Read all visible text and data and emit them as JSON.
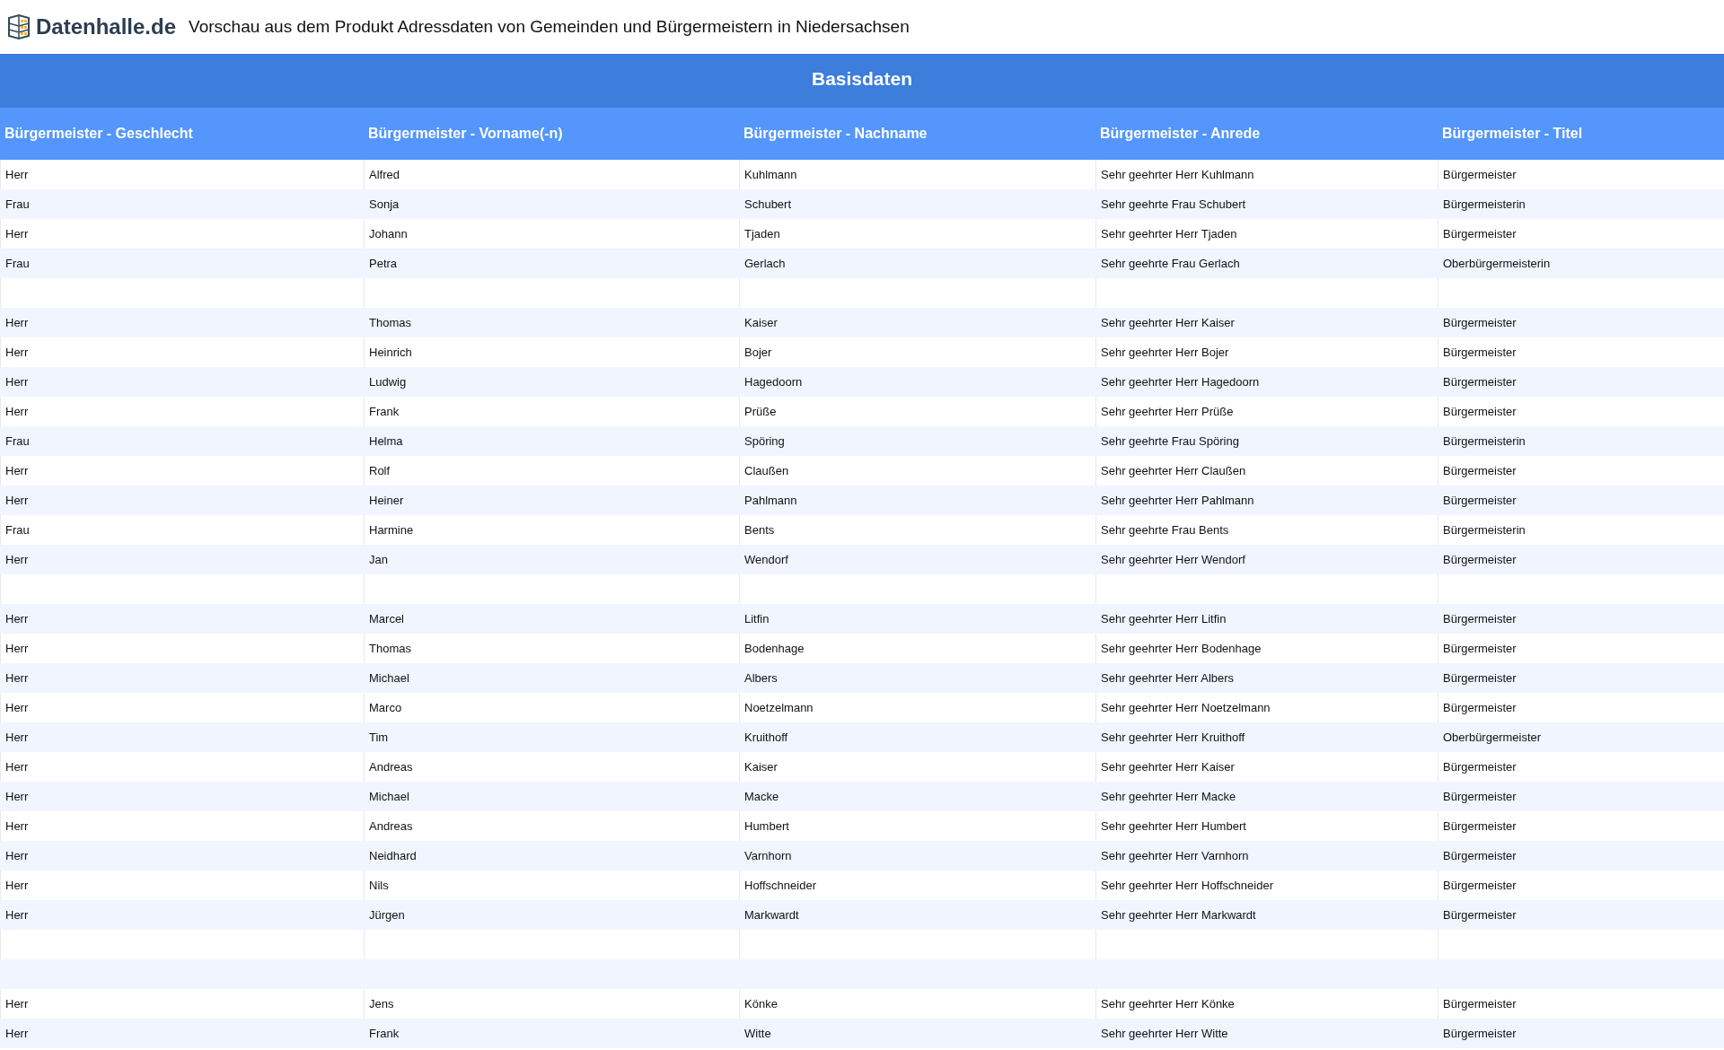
{
  "header": {
    "logo_text": "Datenhalle.de",
    "title": "Vorschau aus dem Produkt Adressdaten von Gemeinden und Bürgermeistern in Niedersachsen"
  },
  "table": {
    "group_title": "Basisdaten",
    "columns": [
      "Bürgermeister - Geschlecht",
      "Bürgermeister - Vorname(-n)",
      "Bürgermeister - Nachname",
      "Bürgermeister - Anrede",
      "Bürgermeister - Titel"
    ],
    "rows": [
      {
        "kind": "data",
        "cells": [
          "Herr",
          "Alfred",
          "Kuhlmann",
          "Sehr geehrter Herr Kuhlmann",
          "Bürgermeister"
        ]
      },
      {
        "kind": "data",
        "cells": [
          "Frau",
          "Sonja",
          "Schubert",
          "Sehr geehrte Frau Schubert",
          "Bürgermeisterin"
        ]
      },
      {
        "kind": "data",
        "cells": [
          "Herr",
          "Johann",
          "Tjaden",
          "Sehr geehrter Herr Tjaden",
          "Bürgermeister"
        ]
      },
      {
        "kind": "data",
        "cells": [
          "Frau",
          "Petra",
          "Gerlach",
          "Sehr geehrte Frau Gerlach",
          "Oberbürgermeisterin"
        ]
      },
      {
        "kind": "blank"
      },
      {
        "kind": "data",
        "cells": [
          "Herr",
          "Thomas",
          "Kaiser",
          "Sehr geehrter Herr Kaiser",
          "Bürgermeister"
        ]
      },
      {
        "kind": "data",
        "cells": [
          "Herr",
          "Heinrich",
          "Bojer",
          "Sehr geehrter Herr Bojer",
          "Bürgermeister"
        ]
      },
      {
        "kind": "data",
        "cells": [
          "Herr",
          "Ludwig",
          "Hagedoorn",
          "Sehr geehrter Herr Hagedoorn",
          "Bürgermeister"
        ]
      },
      {
        "kind": "data",
        "cells": [
          "Herr",
          "Frank",
          "Prüße",
          "Sehr geehrter Herr Prüße",
          "Bürgermeister"
        ]
      },
      {
        "kind": "data",
        "cells": [
          "Frau",
          "Helma",
          "Spöring",
          "Sehr geehrte Frau Spöring",
          "Bürgermeisterin"
        ]
      },
      {
        "kind": "data",
        "cells": [
          "Herr",
          "Rolf",
          "Claußen",
          "Sehr geehrter Herr Claußen",
          "Bürgermeister"
        ]
      },
      {
        "kind": "data",
        "cells": [
          "Herr",
          "Heiner",
          "Pahlmann",
          "Sehr geehrter Herr Pahlmann",
          "Bürgermeister"
        ]
      },
      {
        "kind": "data",
        "cells": [
          "Frau",
          "Harmine",
          "Bents",
          "Sehr geehrte Frau Bents",
          "Bürgermeisterin"
        ]
      },
      {
        "kind": "data",
        "cells": [
          "Herr",
          "Jan",
          "Wendorf",
          "Sehr geehrter Herr Wendorf",
          "Bürgermeister"
        ]
      },
      {
        "kind": "blank"
      },
      {
        "kind": "data",
        "cells": [
          "Herr",
          "Marcel",
          "Litfin",
          "Sehr geehrter Herr Litfin",
          "Bürgermeister"
        ]
      },
      {
        "kind": "data",
        "cells": [
          "Herr",
          "Thomas",
          "Bodenhage",
          "Sehr geehrter Herr Bodenhage",
          "Bürgermeister"
        ]
      },
      {
        "kind": "data",
        "cells": [
          "Herr",
          "Michael",
          "Albers",
          "Sehr geehrter Herr Albers",
          "Bürgermeister"
        ]
      },
      {
        "kind": "data",
        "cells": [
          "Herr",
          "Marco",
          "Noetzelmann",
          "Sehr geehrter Herr Noetzelmann",
          "Bürgermeister"
        ]
      },
      {
        "kind": "data",
        "cells": [
          "Herr",
          "Tim",
          "Kruithoff",
          "Sehr geehrter Herr Kruithoff",
          "Oberbürgermeister"
        ]
      },
      {
        "kind": "data",
        "cells": [
          "Herr",
          "Andreas",
          "Kaiser",
          "Sehr geehrter Herr Kaiser",
          "Bürgermeister"
        ]
      },
      {
        "kind": "data",
        "cells": [
          "Herr",
          "Michael",
          "Macke",
          "Sehr geehrter Herr Macke",
          "Bürgermeister"
        ]
      },
      {
        "kind": "data",
        "cells": [
          "Herr",
          "Andreas",
          "Humbert",
          "Sehr geehrter Herr Humbert",
          "Bürgermeister"
        ]
      },
      {
        "kind": "data",
        "cells": [
          "Herr",
          "Neidhard",
          "Varnhorn",
          "Sehr geehrter Herr Varnhorn",
          "Bürgermeister"
        ]
      },
      {
        "kind": "data",
        "cells": [
          "Herr",
          "Nils",
          "Hoffschneider",
          "Sehr geehrter Herr Hoffschneider",
          "Bürgermeister"
        ]
      },
      {
        "kind": "data",
        "cells": [
          "Herr",
          "Jürgen",
          "Markwardt",
          "Sehr geehrter Herr Markwardt",
          "Bürgermeister"
        ]
      },
      {
        "kind": "blank"
      },
      {
        "kind": "blank"
      },
      {
        "kind": "data",
        "cells": [
          "Herr",
          "Jens",
          "Könke",
          "Sehr geehrter Herr Könke",
          "Bürgermeister"
        ]
      },
      {
        "kind": "data",
        "cells": [
          "Herr",
          "Frank",
          "Witte",
          "Sehr geehrter Herr Witte",
          "Bürgermeister"
        ]
      }
    ]
  }
}
